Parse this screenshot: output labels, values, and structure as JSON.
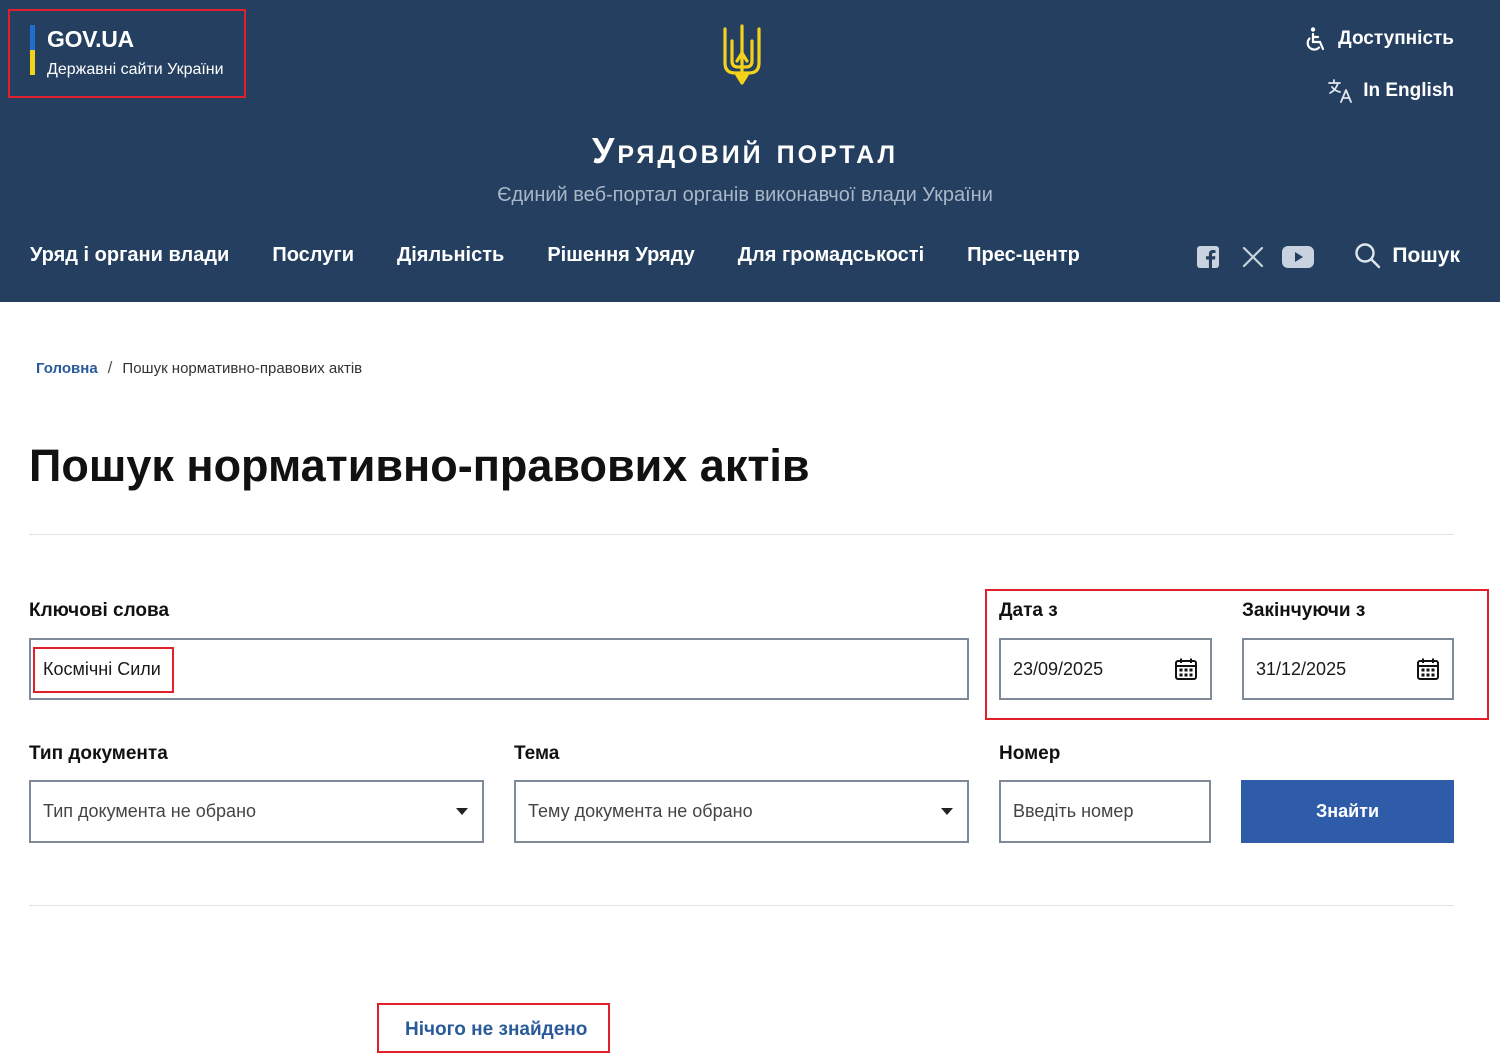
{
  "header": {
    "govua_title": "GOV.UA",
    "govua_subtitle": "Державні сайти України",
    "accessibility": "Доступність",
    "language": "In English",
    "portal_title": "Урядовий портал",
    "portal_subtitle": "Єдиний веб-портал органів виконавчої влади України",
    "nav": [
      "Уряд і органи влади",
      "Послуги",
      "Діяльність",
      "Рішення Уряду",
      "Для громадськості",
      "Прес-центр"
    ],
    "search": "Пошук"
  },
  "breadcrumb": {
    "home": "Головна",
    "separator": "/",
    "current": "Пошук нормативно-правових актів"
  },
  "page": {
    "title": "Пошук нормативно-правових актів"
  },
  "form": {
    "keywords_label": "Ключові слова",
    "keywords_value": "Космічні Сили",
    "date_from_label": "Дата з",
    "date_from_value": "23/09/2025",
    "date_to_label": "Закінчуючи з",
    "date_to_value": "31/12/2025",
    "doc_type_label": "Тип документа",
    "doc_type_value": "Тип документа не обрано",
    "topic_label": "Тема",
    "topic_value": "Тему документа не обрано",
    "number_label": "Номер",
    "number_placeholder": "Введіть номер",
    "submit": "Знайти"
  },
  "results": {
    "message": "Нічого не знайдено"
  },
  "colors": {
    "header_bg": "#243f5f",
    "accent_blue": "#2e5ca8",
    "flag_blue": "#1f6fd1",
    "flag_yellow": "#f2d21b",
    "highlight_red": "#e0202a"
  },
  "icons": [
    "trident-icon",
    "accessibility-icon",
    "translate-icon",
    "facebook-icon",
    "x-icon",
    "youtube-icon",
    "search-icon",
    "calendar-icon",
    "chevron-down-icon"
  ]
}
